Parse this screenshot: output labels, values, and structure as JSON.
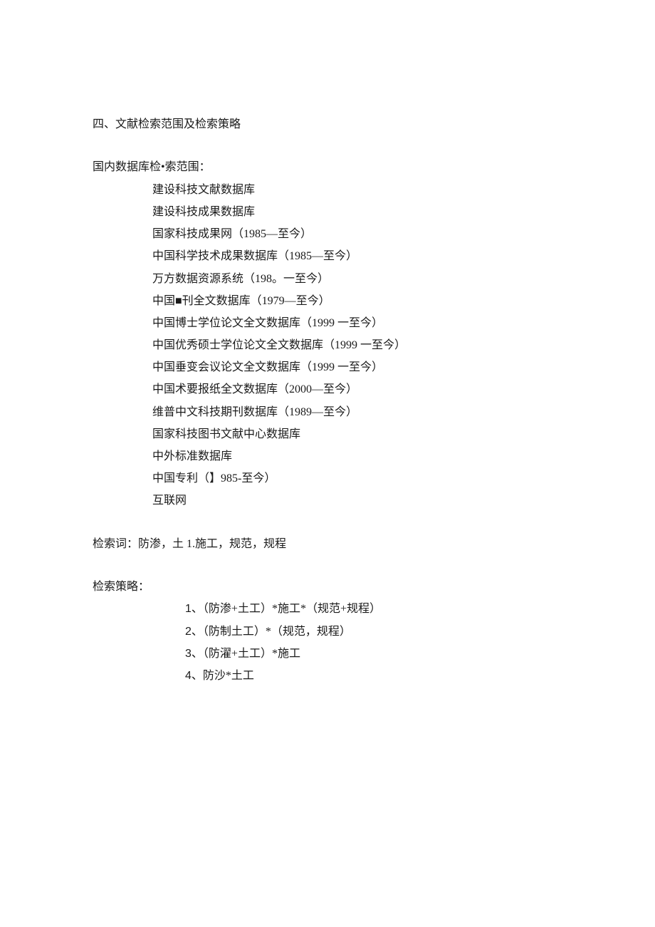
{
  "heading": "四、文献检索范围及检索策略",
  "scope": {
    "label": "国内数据库检•索范围：",
    "items": [
      "建设科技文献数据库",
      "建设科技成果数据库",
      "国家科技成果网（1985—至今）",
      "中国科学技术成果数据库（1985—至今）",
      "万方数据资源系统（198。一至今）",
      "中国■刊全文数据库（1979—至今）",
      "中国博士学位论文全文数据库（1999 一至今）",
      "中国优秀硕士学位论文全文数据库（1999 一至今）",
      "中国垂变会议论文全文数据库（1999 一至今）",
      "中国术要报纸全文数据库（2000—至今）",
      "维普中文科技期刊数据库（1989—至今）",
      "国家科技图书文献中心数据库",
      "中外标准数据库",
      "中国专利（】985-至今）",
      "互联网"
    ]
  },
  "keywords": {
    "label": "检索词：",
    "value": "防渗，土 1.施工，规范，规程"
  },
  "strategy": {
    "label": "检索策略：",
    "items": [
      {
        "num": "1",
        "text": "（防渗+土工）*施工*（规范+规程）"
      },
      {
        "num": "2",
        "text": "（防制土工）*（规范，规程）"
      },
      {
        "num": "3",
        "text": "（防濯+土工）*施工"
      },
      {
        "num": "4",
        "text": "防沙*土工"
      }
    ]
  }
}
